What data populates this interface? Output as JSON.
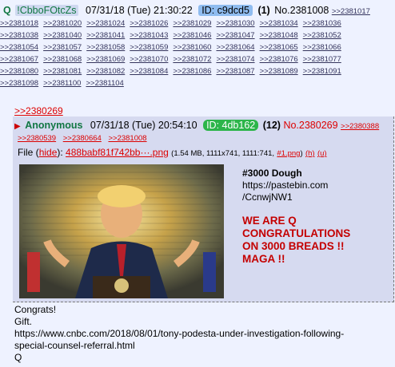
{
  "header": {
    "q": "Q",
    "trip": "!CbboFOtcZs",
    "date": "07/31/18 (Tue) 21:30:22",
    "uid": "ID: c9dcd5",
    "count": "(1)",
    "postno": "No.2381008",
    "self_link": ">>2381017"
  },
  "backlinks": [
    ">>2381018",
    ">>2381020",
    ">>2381024",
    ">>2381026",
    ">>2381029",
    ">>2381030",
    ">>2381034",
    ">>2381036",
    ">>2381038",
    ">>2381040",
    ">>2381041",
    ">>2381043",
    ">>2381046",
    ">>2381047",
    ">>2381048",
    ">>2381052",
    ">>2381054",
    ">>2381057",
    ">>2381058",
    ">>2381059",
    ">>2381060",
    ">>2381064",
    ">>2381065",
    ">>2381066",
    ">>2381067",
    ">>2381068",
    ">>2381069",
    ">>2381070",
    ">>2381072",
    ">>2381074",
    ">>2381076",
    ">>2381077",
    ">>2381080",
    ">>2381081",
    ">>2381082",
    ">>2381084",
    ">>2381086",
    ">>2381087",
    ">>2381089",
    ">>2381091",
    ">>2381098",
    ">>2381100",
    ">>2381104"
  ],
  "reply": {
    "anchor": ">>2380269",
    "name": "Anonymous",
    "date": "07/31/18 (Tue) 20:54:10",
    "uid": "ID: 4db162",
    "count": "(12)",
    "postno": "No.2380269",
    "link": ">>2380388",
    "backlinks": [
      ">>2380539",
      ">>2380664",
      ">>2381008"
    ],
    "file_label": "File",
    "hide": "hide",
    "filename": "488babf81f742bb···.png",
    "meta": "(1.54 MB, 1111x741, 1111:741,",
    "flink": "#1.png",
    "h": "(h)",
    "u": "(u)",
    "lines": [
      "#3000 Dough",
      "https://pastebin.com",
      "/CcnwjNW1"
    ],
    "red": [
      "WE ARE Q",
      "CONGRATULATIONS",
      "ON 3000 BREADS !!",
      "MAGA !!"
    ]
  },
  "body": [
    "Congrats!",
    "Gift.",
    "https://www.cnbc.com/2018/08/01/tony-podesta-under-investigation-following-",
    "special-counsel-referral.html",
    "Q"
  ]
}
